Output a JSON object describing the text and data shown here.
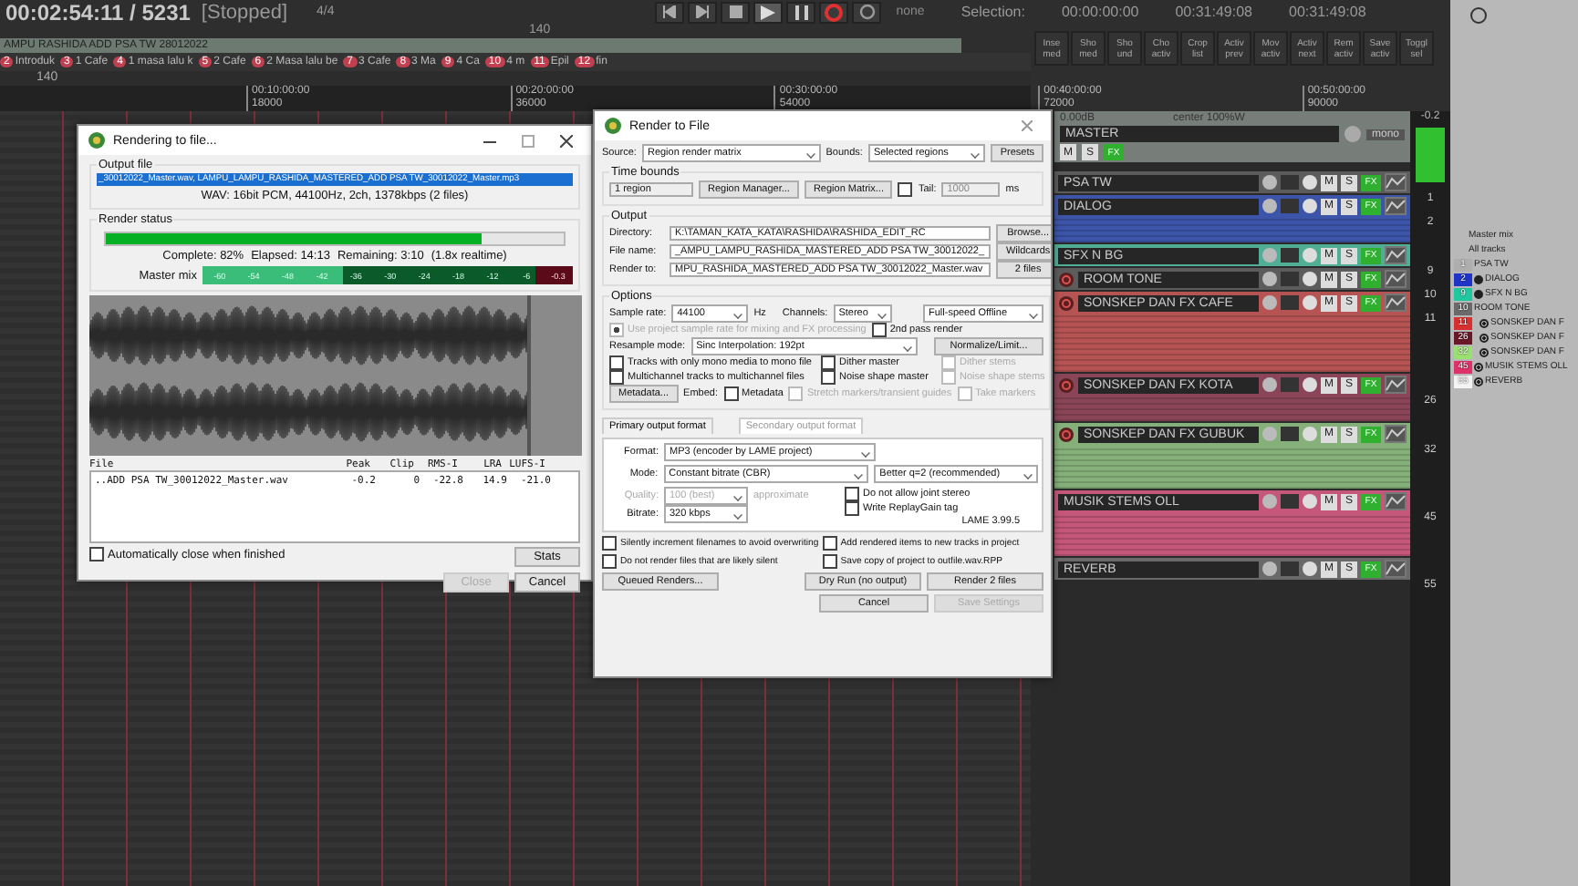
{
  "transport": {
    "time": "00:02:54:11 / 5231",
    "state": "[Stopped]",
    "tempo": "140",
    "signature": "4/4",
    "rate": "none",
    "selection_label": "Selection:",
    "selection_start": "00:00:00:00",
    "selection_end": "00:31:49:08",
    "selection_length": "00:31:49:08"
  },
  "project": {
    "title": "AMPU RASHIDA ADD PSA TW 28012022",
    "tempo_marker": "140"
  },
  "markers": [
    {
      "number": "2",
      "label": "Introduk"
    },
    {
      "number": "3",
      "label": "1 Cafe"
    },
    {
      "number": "4",
      "label": "1 masa lalu k"
    },
    {
      "number": "5",
      "label": "2 Cafe"
    },
    {
      "number": "6",
      "label": "2 Masa lalu be"
    },
    {
      "number": "7",
      "label": "3 Cafe"
    },
    {
      "number": "8",
      "label": "3 Ma"
    },
    {
      "number": "9",
      "label": "4 Ca"
    },
    {
      "number": "10",
      "label": "4 m"
    },
    {
      "number": "11",
      "label": "Epil"
    },
    {
      "number": "12",
      "label": "fin"
    }
  ],
  "ruler": [
    {
      "time": "00:10:00:00",
      "beats": "18000"
    },
    {
      "time": "00:20:00:00",
      "beats": "36000"
    },
    {
      "time": "00:30:00:00",
      "beats": "54000"
    },
    {
      "time": "00:40:00:00",
      "beats": "72000"
    },
    {
      "time": "00:50:00:00",
      "beats": "90000"
    }
  ],
  "toolbar": [
    "Inse med",
    "Sho med",
    "Sho und",
    "Cho activ",
    "Crop list",
    "Activ prev",
    "Mov activ",
    "Activ next",
    "Rem activ",
    "Save activ",
    "Toggl sel"
  ],
  "master": {
    "name": "MASTER",
    "volume": "0.00dB",
    "pan": "center 100%W",
    "mono": "mono",
    "peak": "-0.2",
    "mute": "M",
    "solo": "S",
    "fx": "FX"
  },
  "tracks": [
    {
      "name": "PSA TW",
      "color": "#5c5c5c",
      "number": "1",
      "armable": false,
      "kind": "none",
      "mute": "M",
      "solo": "S",
      "fx": "FX"
    },
    {
      "name": "DIALOG",
      "color": "#3d55a8",
      "number": "2",
      "armable": false,
      "kind": "tall",
      "mute": "M",
      "solo": "S",
      "fx": "FX"
    },
    {
      "name": "SFX N BG",
      "color": "#4fae94",
      "number": "9",
      "armable": false,
      "kind": "none",
      "mute": "M",
      "solo": "S",
      "fx": "FX"
    },
    {
      "name": "ROOM TONE",
      "color": "#5c5c5c",
      "number": "10",
      "armable": true,
      "kind": "none",
      "mute": "M",
      "solo": "S",
      "fx": "FX"
    },
    {
      "name": "SONSKEP DAN FX CAFE",
      "color": "#b65454",
      "number": "11",
      "armable": true,
      "kind": "huge",
      "mute": "M",
      "solo": "S",
      "fx": "FX"
    },
    {
      "name": "SONSKEP DAN FX KOTA",
      "color": "#8a4658",
      "number": "26",
      "armable": true,
      "kind": "tall",
      "mute": "M",
      "solo": "S",
      "fx": "FX"
    },
    {
      "name": "SONSKEP DAN FX GUBUK",
      "color": "#86b07a",
      "number": "32",
      "armable": true,
      "kind": "big",
      "mute": "M",
      "solo": "S",
      "fx": "FX"
    },
    {
      "name": "MUSIK STEMS OLL",
      "color": "#c4577a",
      "number": "45",
      "armable": false,
      "kind": "big",
      "mute": "M",
      "solo": "S",
      "fx": "FX"
    },
    {
      "name": "REVERB",
      "color": "#6a6a6a",
      "number": "55",
      "armable": false,
      "kind": "none",
      "mute": "M",
      "solo": "S",
      "fx": "FX"
    }
  ],
  "routing": {
    "title": "Master mix",
    "subtitle": "All tracks",
    "items": [
      {
        "number": "1",
        "name": "PSA TW",
        "color": "#aeaeae",
        "kind": "plain"
      },
      {
        "number": "2",
        "name": "DIALOG",
        "color": "#2034c8",
        "kind": "folder"
      },
      {
        "number": "9",
        "name": "SFX N BG",
        "color": "#20c8a0",
        "kind": "folder",
        "children": [
          {
            "number": "10",
            "name": "ROOM TONE",
            "color": "#6a6a6a",
            "kind": "plain"
          },
          {
            "number": "11",
            "name": "SONSKEP DAN F",
            "color": "#d83030",
            "kind": "dot"
          },
          {
            "number": "26",
            "name": "SONSKEP DAN F",
            "color": "#6a1828",
            "kind": "dot"
          },
          {
            "number": "32",
            "name": "SONSKEP DAN F",
            "color": "#9ae070",
            "kind": "dot"
          }
        ]
      },
      {
        "number": "45",
        "name": "MUSIK STEMS OLL",
        "color": "#e0306a",
        "kind": "dot"
      },
      {
        "number": "55",
        "name": "REVERB",
        "color": "#f4f4f4",
        "kind": "dot"
      }
    ]
  },
  "progress_dialog": {
    "title": "Rendering to file...",
    "output_group": "Output file",
    "output_path": "_30012022_Master.wav, LAMPU_LAMPU_RASHIDA_MASTERED_ADD PSA TW_30012022_Master.mp3",
    "format": "WAV: 16bit PCM, 44100Hz, 2ch, 1378kbps (2 files)",
    "status_group": "Render status",
    "level": 0.82,
    "complete": "Complete: 82%",
    "elapsed": "Elapsed: 14:13",
    "remaining": "Remaining: 3:10",
    "realtime": "(1.8x realtime)",
    "meter_label": "Master mix",
    "meter_scale": [
      "-60",
      "-54",
      "-48",
      "-42",
      "-36",
      "-30",
      "-24",
      "-18",
      "-12",
      "-6"
    ],
    "meter_peak": "-0.3",
    "columns": [
      "File",
      "Peak",
      "Clip",
      "RMS-I",
      "LRA",
      "LUFS-I"
    ],
    "rows": [
      [
        "..ADD PSA TW_30012022_Master.wav",
        "-0.2",
        "0",
        "-22.8",
        "14.9",
        "-21.0"
      ]
    ],
    "auto_close": {
      "label": "Automatically close when finished",
      "checked": false
    },
    "buttons": [
      {
        "label": "Stats",
        "disabled": false
      },
      {
        "label": "Close",
        "disabled": true
      },
      {
        "label": "Cancel",
        "disabled": false
      }
    ]
  },
  "render_dialog": {
    "title": "Render to File",
    "source_label": "Source:",
    "source": "Region render matrix",
    "bounds_label": "Bounds:",
    "bounds": "Selected regions",
    "presets": "Presets",
    "time_bounds": "Time bounds",
    "regions": "1 region",
    "region_manager": "Region Manager...",
    "region_matrix": "Region Matrix...",
    "tail": {
      "label": "Tail:",
      "checked": false,
      "disabled": true,
      "value": "1000",
      "unit": "ms"
    },
    "output_group": "Output",
    "fields": [
      {
        "label": "Directory:",
        "value": "K:\\TAMAN_KATA_KATA\\RASHIDA\\RASHIDA_EDIT_RC",
        "button": "Browse..."
      },
      {
        "label": "File name:",
        "value": "_AMPU_LAMPU_RASHIDA_MASTERED_ADD PSA TW_30012022_",
        "button": "Wildcards"
      },
      {
        "label": "Render to:",
        "value": "MPU_RASHIDA_MASTERED_ADD PSA TW_30012022_Master.wav",
        "button": "2 files"
      }
    ],
    "options_group": "Options",
    "sample_rate_label": "Sample rate:",
    "sample_rate": "44100",
    "sample_rate_unit": "Hz",
    "channels_label": "Channels:",
    "channels": "Stereo",
    "speed": "Full-speed Offline",
    "project_rate": {
      "label": "Use project sample rate for mixing and FX processing",
      "checked": true,
      "disabled": true
    },
    "second_pass": {
      "label": "2nd pass render",
      "checked": false,
      "disabled": false
    },
    "resample_label": "Resample mode:",
    "resample": "Sinc Interpolation: 192pt",
    "normalize": "Normalize/Limit...",
    "check_rows": [
      [
        {
          "label": "Tracks with only mono media to mono file",
          "checked": false,
          "disabled": false
        },
        {
          "label": "Dither master",
          "checked": false,
          "disabled": false
        },
        {
          "label": "Dither stems",
          "checked": false,
          "disabled": true
        }
      ],
      [
        {
          "label": "Multichannel tracks to multichannel files",
          "checked": false,
          "disabled": false
        },
        {
          "label": "Noise shape master",
          "checked": false,
          "disabled": false
        },
        {
          "label": "Noise shape stems",
          "checked": false,
          "disabled": true
        }
      ]
    ],
    "metadata": "Metadata...",
    "embed_label": "Embed:",
    "embed_checks": [
      {
        "label": "Metadata",
        "checked": false,
        "disabled": false
      },
      {
        "label": "Stretch markers/transient guides",
        "checked": false,
        "disabled": true
      },
      {
        "label": "Take markers",
        "checked": false,
        "disabled": true
      }
    ],
    "tabs": [
      {
        "label": "Primary output format",
        "selected": false
      },
      {
        "label": "Secondary output format",
        "selected": true
      }
    ],
    "format_label": "Format:",
    "format": "MP3 (encoder by LAME project)",
    "mode_label": "Mode:",
    "mode": "Constant bitrate  (CBR)",
    "encoding_quality": "Better q=2 (recommended)",
    "quality_label": "Quality:",
    "quality": "100 (best)",
    "approximate": "approximate",
    "bitrate_label": "Bitrate:",
    "bitrate": "320 kbps",
    "lame_checks": [
      {
        "label": "Do not allow joint stereo",
        "checked": false,
        "disabled": false
      },
      {
        "label": "Write ReplayGain tag",
        "checked": false,
        "disabled": false
      }
    ],
    "lame_version": "LAME 3.99.5",
    "bottom_checks": [
      {
        "label": "Silently increment filenames to avoid overwriting",
        "checked": false,
        "disabled": false
      },
      {
        "label": "Add rendered items to new tracks in project",
        "checked": false,
        "disabled": false
      },
      {
        "label": "Do not render files that are likely silent",
        "checked": false,
        "disabled": false
      },
      {
        "label": "Save copy of project to outfile.wav.RPP",
        "checked": false,
        "disabled": false
      }
    ],
    "queued": "Queued Renders...",
    "dry_run": "Dry Run (no output)",
    "render": "Render 2 files",
    "cancel": "Cancel",
    "save_settings": {
      "label": "Save Settings",
      "disabled": true
    }
  }
}
